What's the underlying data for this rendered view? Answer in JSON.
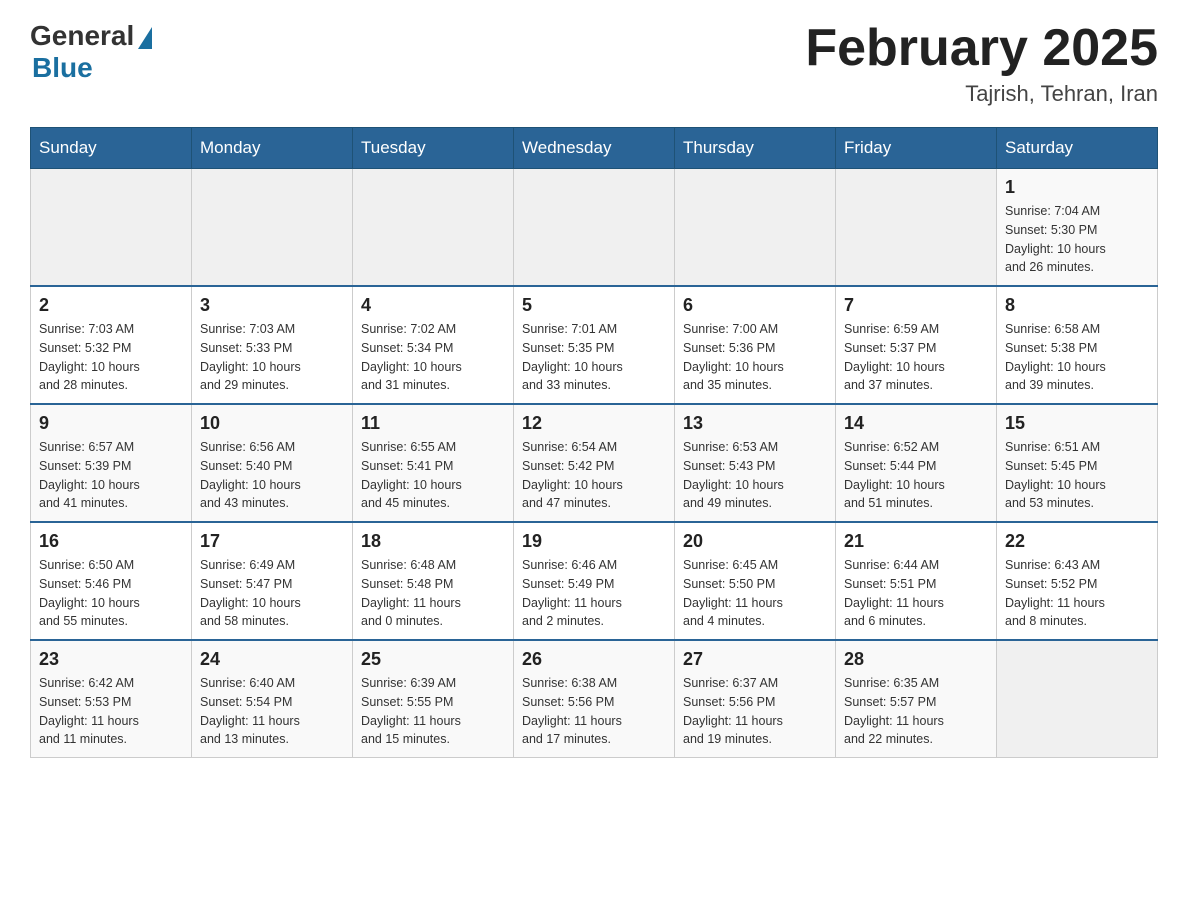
{
  "header": {
    "logo_general": "General",
    "logo_blue": "Blue",
    "month_title": "February 2025",
    "subtitle": "Tajrish, Tehran, Iran"
  },
  "weekdays": [
    "Sunday",
    "Monday",
    "Tuesday",
    "Wednesday",
    "Thursday",
    "Friday",
    "Saturday"
  ],
  "weeks": [
    [
      {
        "day": "",
        "info": ""
      },
      {
        "day": "",
        "info": ""
      },
      {
        "day": "",
        "info": ""
      },
      {
        "day": "",
        "info": ""
      },
      {
        "day": "",
        "info": ""
      },
      {
        "day": "",
        "info": ""
      },
      {
        "day": "1",
        "info": "Sunrise: 7:04 AM\nSunset: 5:30 PM\nDaylight: 10 hours\nand 26 minutes."
      }
    ],
    [
      {
        "day": "2",
        "info": "Sunrise: 7:03 AM\nSunset: 5:32 PM\nDaylight: 10 hours\nand 28 minutes."
      },
      {
        "day": "3",
        "info": "Sunrise: 7:03 AM\nSunset: 5:33 PM\nDaylight: 10 hours\nand 29 minutes."
      },
      {
        "day": "4",
        "info": "Sunrise: 7:02 AM\nSunset: 5:34 PM\nDaylight: 10 hours\nand 31 minutes."
      },
      {
        "day": "5",
        "info": "Sunrise: 7:01 AM\nSunset: 5:35 PM\nDaylight: 10 hours\nand 33 minutes."
      },
      {
        "day": "6",
        "info": "Sunrise: 7:00 AM\nSunset: 5:36 PM\nDaylight: 10 hours\nand 35 minutes."
      },
      {
        "day": "7",
        "info": "Sunrise: 6:59 AM\nSunset: 5:37 PM\nDaylight: 10 hours\nand 37 minutes."
      },
      {
        "day": "8",
        "info": "Sunrise: 6:58 AM\nSunset: 5:38 PM\nDaylight: 10 hours\nand 39 minutes."
      }
    ],
    [
      {
        "day": "9",
        "info": "Sunrise: 6:57 AM\nSunset: 5:39 PM\nDaylight: 10 hours\nand 41 minutes."
      },
      {
        "day": "10",
        "info": "Sunrise: 6:56 AM\nSunset: 5:40 PM\nDaylight: 10 hours\nand 43 minutes."
      },
      {
        "day": "11",
        "info": "Sunrise: 6:55 AM\nSunset: 5:41 PM\nDaylight: 10 hours\nand 45 minutes."
      },
      {
        "day": "12",
        "info": "Sunrise: 6:54 AM\nSunset: 5:42 PM\nDaylight: 10 hours\nand 47 minutes."
      },
      {
        "day": "13",
        "info": "Sunrise: 6:53 AM\nSunset: 5:43 PM\nDaylight: 10 hours\nand 49 minutes."
      },
      {
        "day": "14",
        "info": "Sunrise: 6:52 AM\nSunset: 5:44 PM\nDaylight: 10 hours\nand 51 minutes."
      },
      {
        "day": "15",
        "info": "Sunrise: 6:51 AM\nSunset: 5:45 PM\nDaylight: 10 hours\nand 53 minutes."
      }
    ],
    [
      {
        "day": "16",
        "info": "Sunrise: 6:50 AM\nSunset: 5:46 PM\nDaylight: 10 hours\nand 55 minutes."
      },
      {
        "day": "17",
        "info": "Sunrise: 6:49 AM\nSunset: 5:47 PM\nDaylight: 10 hours\nand 58 minutes."
      },
      {
        "day": "18",
        "info": "Sunrise: 6:48 AM\nSunset: 5:48 PM\nDaylight: 11 hours\nand 0 minutes."
      },
      {
        "day": "19",
        "info": "Sunrise: 6:46 AM\nSunset: 5:49 PM\nDaylight: 11 hours\nand 2 minutes."
      },
      {
        "day": "20",
        "info": "Sunrise: 6:45 AM\nSunset: 5:50 PM\nDaylight: 11 hours\nand 4 minutes."
      },
      {
        "day": "21",
        "info": "Sunrise: 6:44 AM\nSunset: 5:51 PM\nDaylight: 11 hours\nand 6 minutes."
      },
      {
        "day": "22",
        "info": "Sunrise: 6:43 AM\nSunset: 5:52 PM\nDaylight: 11 hours\nand 8 minutes."
      }
    ],
    [
      {
        "day": "23",
        "info": "Sunrise: 6:42 AM\nSunset: 5:53 PM\nDaylight: 11 hours\nand 11 minutes."
      },
      {
        "day": "24",
        "info": "Sunrise: 6:40 AM\nSunset: 5:54 PM\nDaylight: 11 hours\nand 13 minutes."
      },
      {
        "day": "25",
        "info": "Sunrise: 6:39 AM\nSunset: 5:55 PM\nDaylight: 11 hours\nand 15 minutes."
      },
      {
        "day": "26",
        "info": "Sunrise: 6:38 AM\nSunset: 5:56 PM\nDaylight: 11 hours\nand 17 minutes."
      },
      {
        "day": "27",
        "info": "Sunrise: 6:37 AM\nSunset: 5:56 PM\nDaylight: 11 hours\nand 19 minutes."
      },
      {
        "day": "28",
        "info": "Sunrise: 6:35 AM\nSunset: 5:57 PM\nDaylight: 11 hours\nand 22 minutes."
      },
      {
        "day": "",
        "info": ""
      }
    ]
  ]
}
